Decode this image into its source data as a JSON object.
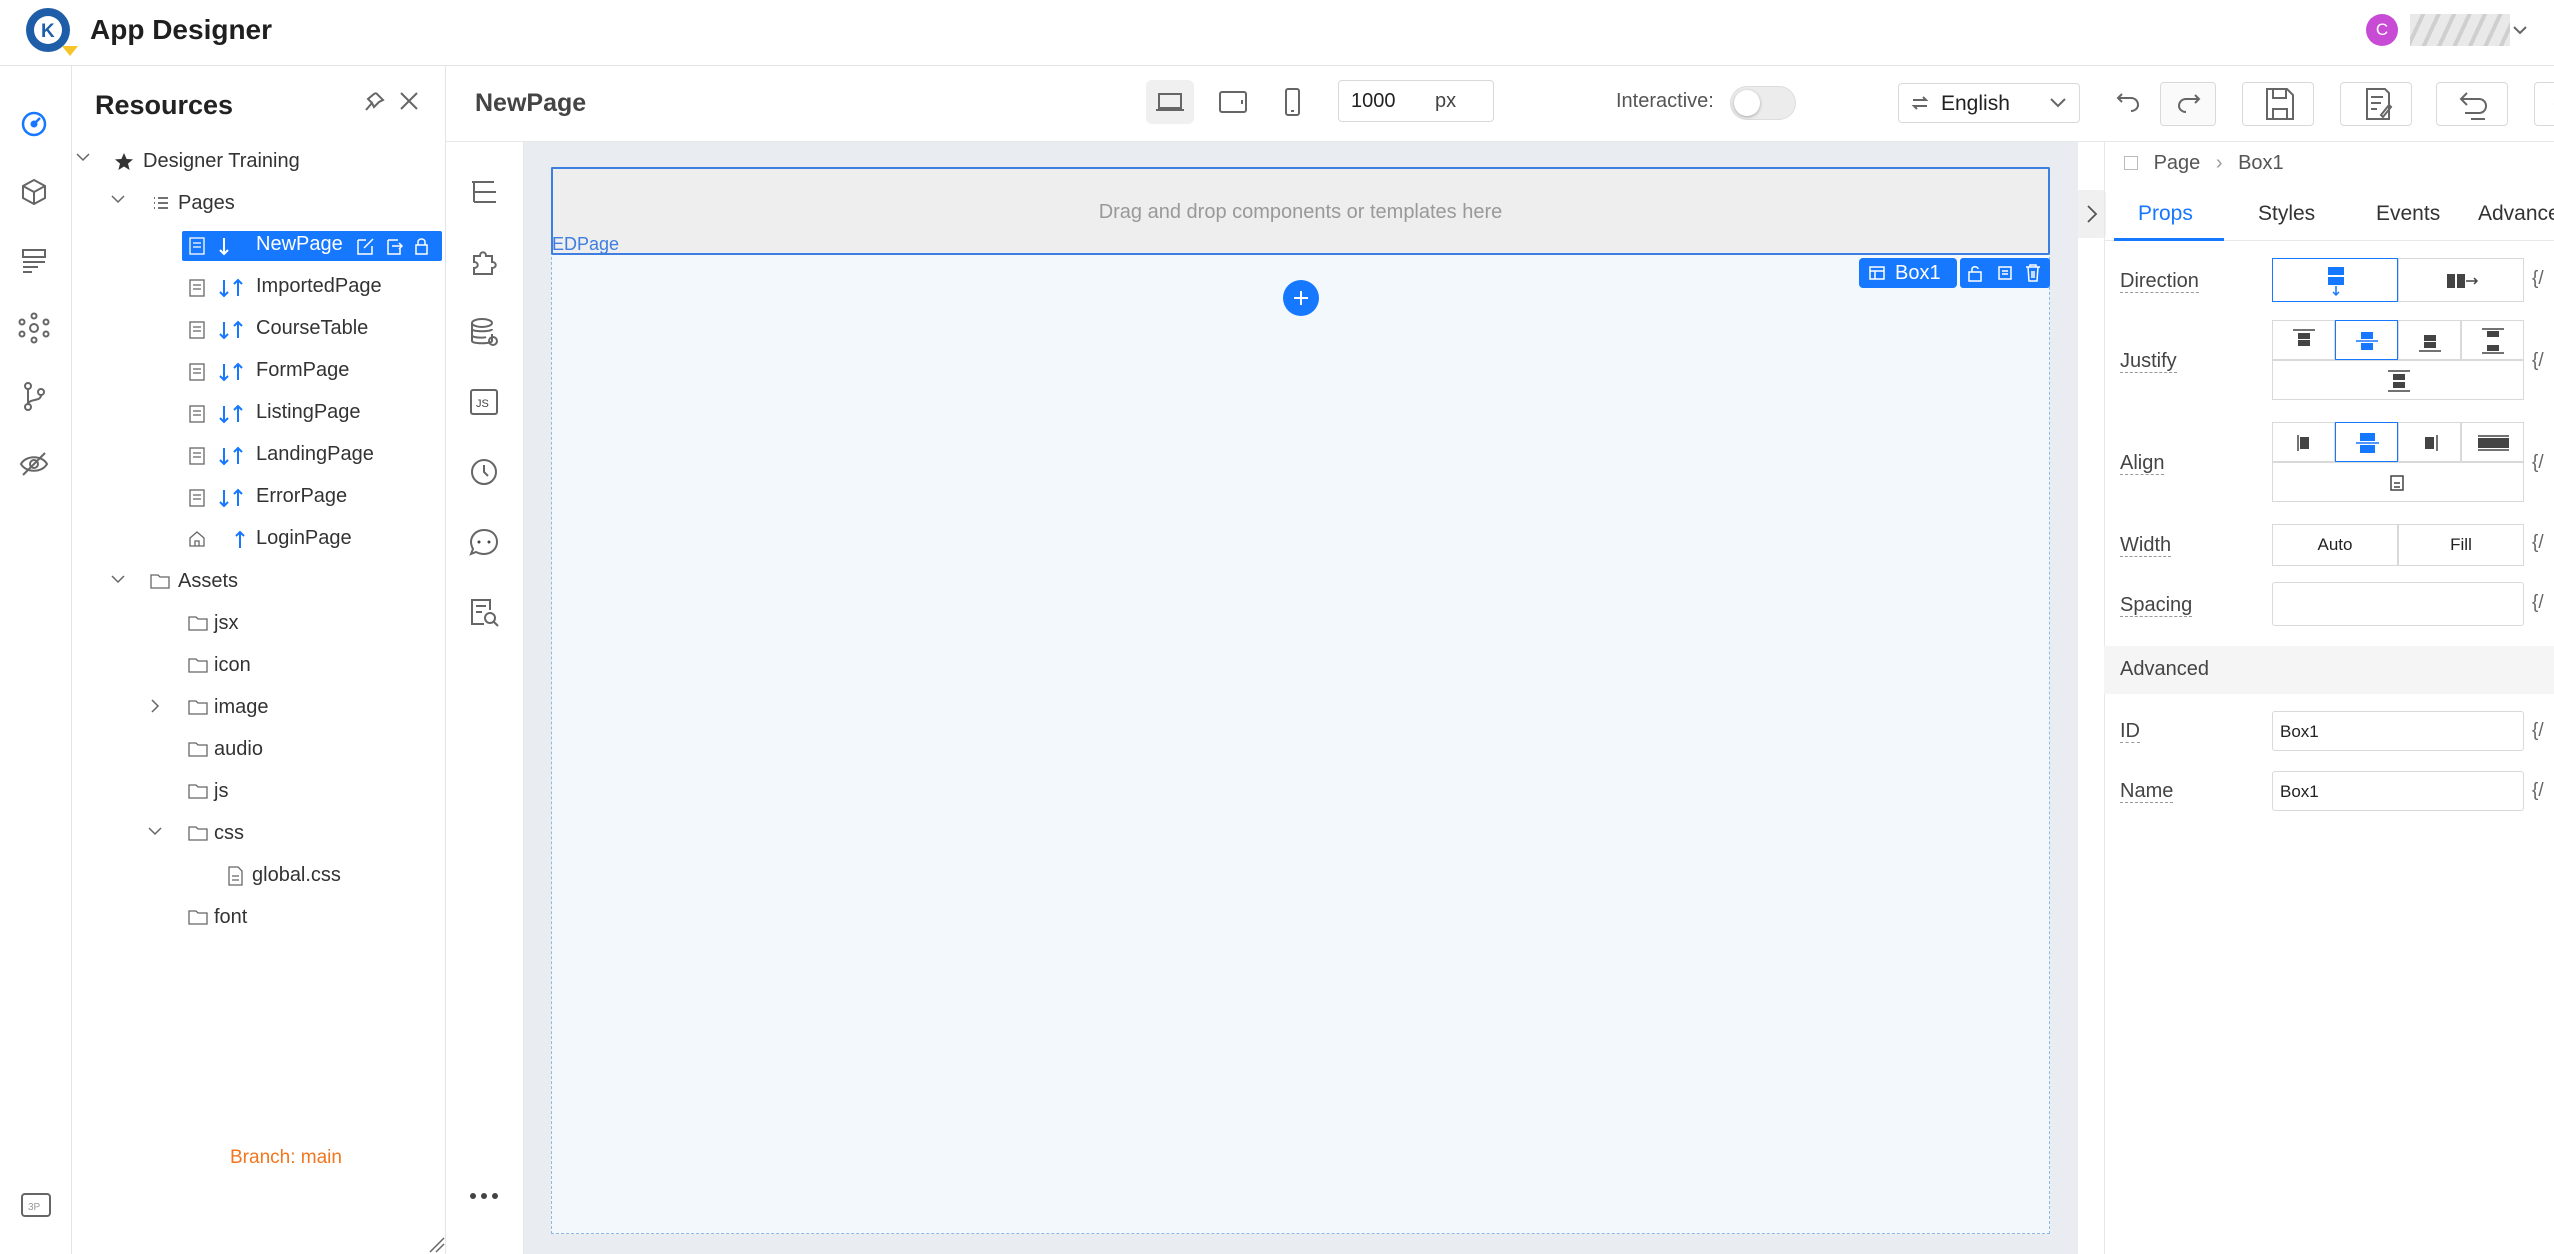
{
  "header": {
    "app_title": "App Designer",
    "avatar_initial": "C"
  },
  "left_rail": {
    "icons": [
      "dashboard-icon",
      "cube-icon",
      "list-icon",
      "network-icon",
      "branch-icon",
      "eye-off-icon"
    ],
    "bottom_badge": "3P"
  },
  "resources": {
    "title": "Resources",
    "root": "Designer Training",
    "pages_folder": "Pages",
    "pages": [
      "NewPage",
      "ImportedPage",
      "CourseTable",
      "FormPage",
      "ListingPage",
      "LandingPage",
      "ErrorPage",
      "LoginPage"
    ],
    "selected_page": "NewPage",
    "assets_folder": "Assets",
    "assets": [
      "jsx",
      "icon",
      "image",
      "audio",
      "js",
      "css",
      "font"
    ],
    "css_files": [
      "global.css"
    ],
    "branch": "Branch: main"
  },
  "pagebar": {
    "page_name": "NewPage",
    "width_value": "1000",
    "width_unit": "px",
    "interactive_label": "Interactive:",
    "interactive_on": false,
    "language": "English"
  },
  "canvas": {
    "drop_text": "Drag and drop components or templates here",
    "page_tag": "EDPage",
    "selected_component": "Box1"
  },
  "props": {
    "breadcrumb_root": "Page",
    "breadcrumb_current": "Box1",
    "tabs": [
      "Props",
      "Styles",
      "Events",
      "Advance"
    ],
    "active_tab": "Props",
    "direction_label": "Direction",
    "justify_label": "Justify",
    "align_label": "Align",
    "width_label": "Width",
    "width_options": [
      "Auto",
      "Fill"
    ],
    "spacing_label": "Spacing",
    "spacing_value": "",
    "brace": "{/",
    "advanced_label": "Advanced",
    "id_label": "ID",
    "id_value": "Box1",
    "name_label": "Name",
    "name_value": "Box1"
  },
  "colors": {
    "accent": "#1677ff",
    "branch": "#f2761d",
    "avatar": "#c84bd6"
  }
}
